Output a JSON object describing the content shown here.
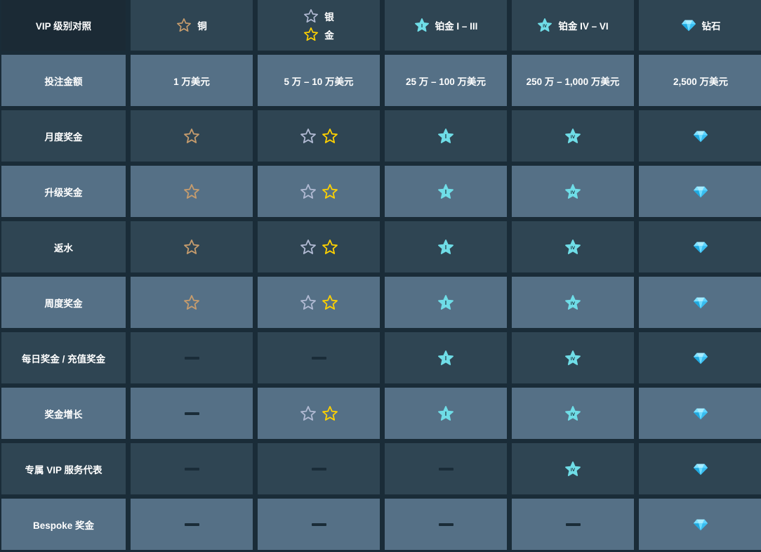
{
  "header": {
    "corner": "VIP 级别对照",
    "bronze": "铜",
    "silver": "银",
    "gold": "金",
    "plat1": "铂金 I – III",
    "plat4": "铂金 IV – VI",
    "diamond": "钻石"
  },
  "rows": [
    {
      "label": "投注金额",
      "values": [
        "1 万美元",
        "5 万 – 10 万美元",
        "25 万 – 100 万美元",
        "250 万 – 1,000 万美元",
        "2,500 万美元"
      ]
    },
    {
      "label": "月度奖金",
      "values": [
        "bronze-star",
        "silver-gold-stars",
        "plat1-star",
        "plat4-star",
        "diamond"
      ]
    },
    {
      "label": "升级奖金",
      "values": [
        "bronze-star",
        "silver-gold-stars",
        "plat1-star",
        "plat4-star",
        "diamond"
      ]
    },
    {
      "label": "返水",
      "values": [
        "bronze-star",
        "silver-gold-stars",
        "plat1-star",
        "plat4-star",
        "diamond"
      ]
    },
    {
      "label": "周度奖金",
      "values": [
        "bronze-star",
        "silver-gold-stars",
        "plat1-star",
        "plat4-star",
        "diamond"
      ]
    },
    {
      "label": "每日奖金 / 充值奖金",
      "values": [
        "dash",
        "dash",
        "plat1-star",
        "plat4-star",
        "diamond"
      ]
    },
    {
      "label": "奖金增长",
      "values": [
        "dash",
        "silver-gold-stars",
        "plat1-star",
        "plat4-star",
        "diamond"
      ]
    },
    {
      "label": "专属 VIP 服务代表",
      "values": [
        "dash",
        "dash",
        "dash",
        "plat4-star",
        "diamond"
      ]
    },
    {
      "label": "Bespoke 奖金",
      "values": [
        "dash",
        "dash",
        "dash",
        "dash",
        "diamond"
      ]
    }
  ],
  "colors": {
    "bronze": "#c69c6d",
    "silver": "#b1bad3",
    "gold": "#fed100",
    "platinum": "#6fdde7",
    "diamond": "#4fd1ff"
  },
  "icons": {
    "bronze": "bronze-star-icon",
    "silver": "silver-star-icon",
    "gold": "gold-star-icon",
    "plat1": "platinum-i-star-icon",
    "plat4": "platinum-iv-star-icon",
    "diamond": "diamond-icon",
    "dash": "dash-icon"
  },
  "badge_text": {
    "plat1": "I",
    "plat4": "IV"
  }
}
